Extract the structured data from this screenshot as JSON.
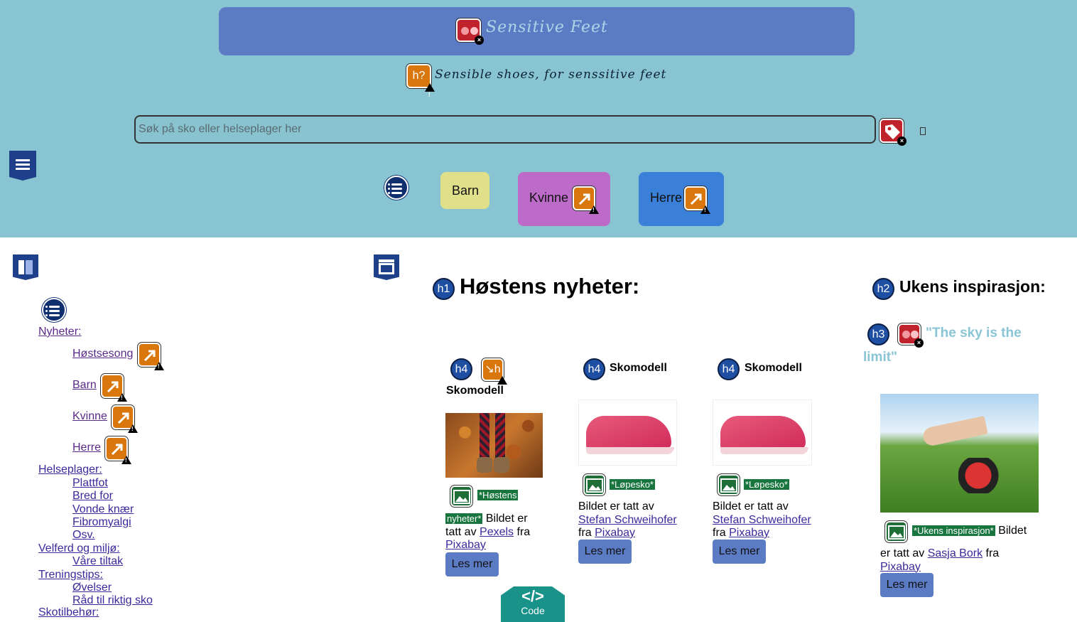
{
  "header": {
    "site_title": "Sensitive Feet",
    "tagline": "Sensible shoes, for senssitive feet",
    "h2_badge": "h?"
  },
  "search": {
    "placeholder": "Søk på sko eller helseplager her"
  },
  "nav": {
    "items": [
      {
        "label": "Barn"
      },
      {
        "label": "Kvinne"
      },
      {
        "label": "Herre"
      }
    ]
  },
  "sidebar": {
    "sections": [
      {
        "label": "Nyheter:",
        "children": [
          "Høstsesong",
          "Barn",
          "Kvinne",
          "Herre"
        ]
      },
      {
        "label": "Helseplager:",
        "children": [
          "Plattfot",
          "Bred for",
          "Vonde knær",
          "Fibromyalgi",
          "Osv."
        ]
      },
      {
        "label": "Velferd og miljø:",
        "children": [
          "Våre tiltak"
        ]
      },
      {
        "label": "Treningstips:",
        "children": [
          "Øvelser",
          "Råd til riktig sko"
        ]
      },
      {
        "label": "Skotilbehør:"
      }
    ]
  },
  "main": {
    "heading_badge": "h1",
    "heading": "Høstens nyheter:",
    "cards": [
      {
        "badge": "h4",
        "title": "Skomodell",
        "alt_chip_1": "*Høstens",
        "alt_chip_2": "nyheter*",
        "credit_prefix": "Bildet er tatt av",
        "author": "Pexels",
        "from": "fra",
        "source": "Pixabay",
        "button": "Les mer"
      },
      {
        "badge": "h4",
        "title": "Skomodell",
        "alt_chip": "*Løpesko*",
        "credit_prefix": "Bildet er tatt av",
        "author": "Stefan Schweihofer",
        "from": "fra",
        "source": "Pixabay",
        "button": "Les mer"
      },
      {
        "badge": "h4",
        "title": "Skomodell",
        "alt_chip": "*Løpesko*",
        "credit_prefix": "Bildet er tatt av",
        "author": "Stefan Schweihofer",
        "from": "fra",
        "source": "Pixabay",
        "button": "Les mer"
      }
    ]
  },
  "aside": {
    "heading_badge": "h2",
    "heading": "Ukens inspirasjon:",
    "quote_badge": "h3",
    "quote_line1": "\"The sky is the",
    "quote_line2": "limit\"",
    "alt_chip": "*Ukens inspirasjon*",
    "credit_suffix": "Bildet",
    "credit_prefix": "er tatt av",
    "author": "Sasja Bork",
    "from": "fra",
    "source": "Pixabay",
    "button": "Les mer"
  },
  "code_badge": {
    "label": "Code"
  }
}
